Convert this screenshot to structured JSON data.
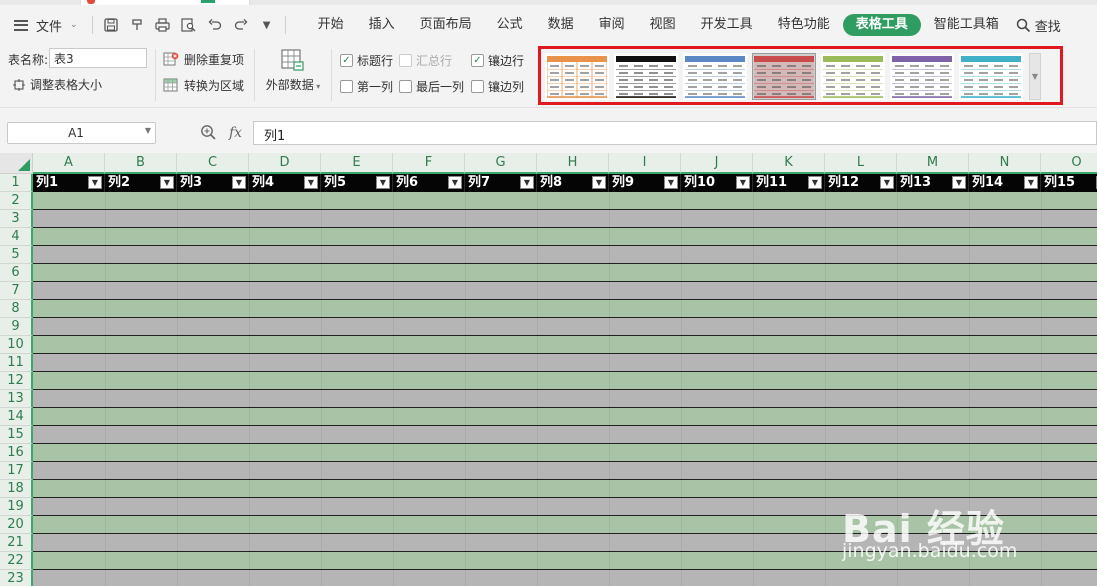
{
  "menu": {
    "file_label": "文件",
    "tabs": [
      {
        "label": "开始"
      },
      {
        "label": "插入"
      },
      {
        "label": "页面布局"
      },
      {
        "label": "公式"
      },
      {
        "label": "数据"
      },
      {
        "label": "审阅"
      },
      {
        "label": "视图"
      },
      {
        "label": "开发工具"
      },
      {
        "label": "特色功能"
      },
      {
        "label": "表格工具",
        "active": true
      },
      {
        "label": "智能工具箱"
      }
    ],
    "search_label": "查找",
    "quick_access_icons": [
      "save-icon",
      "format-painter-icon",
      "print-icon",
      "print-preview-icon",
      "undo-icon",
      "redo-icon",
      "customize-icon"
    ]
  },
  "ribbon": {
    "table_name_label": "表名称:",
    "table_name_value": "表3",
    "resize_label": "调整表格大小",
    "remove_dup_label": "删除重复项",
    "convert_label": "转换为区域",
    "external_data_label": "外部数据",
    "checkboxes": [
      {
        "label": "标题行",
        "checked": true,
        "enabled": true
      },
      {
        "label": "汇总行",
        "checked": false,
        "enabled": false
      },
      {
        "label": "镶边行",
        "checked": true,
        "enabled": true
      },
      {
        "label": "第一列",
        "checked": false,
        "enabled": true
      },
      {
        "label": "最后一列",
        "checked": false,
        "enabled": true
      },
      {
        "label": "镶边列",
        "checked": false,
        "enabled": true
      }
    ],
    "table_styles": [
      {
        "name": "orange-style",
        "accent": "#e8924a",
        "selected": false
      },
      {
        "name": "black-style",
        "accent": "#111111",
        "selected": false
      },
      {
        "name": "blue-style",
        "accent": "#5b87c5",
        "selected": false
      },
      {
        "name": "red-style",
        "accent": "#c84c4c",
        "selected": true
      },
      {
        "name": "green-style",
        "accent": "#9bbb59",
        "selected": false
      },
      {
        "name": "purple-style",
        "accent": "#7f63a8",
        "selected": false
      },
      {
        "name": "teal-style",
        "accent": "#3fb0c8",
        "selected": false
      }
    ]
  },
  "formula_bar": {
    "name_box": "A1",
    "fx_label": "fx",
    "formula": "列1"
  },
  "sheet": {
    "column_letters": [
      "A",
      "B",
      "C",
      "D",
      "E",
      "F",
      "G",
      "H",
      "I",
      "J",
      "K",
      "L",
      "M",
      "N",
      "O"
    ],
    "header_cells": [
      "列1",
      "列2",
      "列3",
      "列4",
      "列5",
      "列6",
      "列7",
      "列8",
      "列9",
      "列10",
      "列11",
      "列12",
      "列13",
      "列14",
      "列15"
    ],
    "row_numbers": [
      "1",
      "2",
      "3",
      "4",
      "5",
      "6",
      "7",
      "8",
      "9",
      "10",
      "11",
      "12",
      "13",
      "14",
      "15",
      "16",
      "17",
      "18",
      "19",
      "20",
      "21",
      "22",
      "23"
    ]
  },
  "watermark": {
    "logo": "Bai 经验",
    "url": "jingyan.baidu.com"
  },
  "colors": {
    "accent_green": "#2f9d62",
    "header_row": "#050505",
    "band_green": "#a8c3a6",
    "band_gray": "#b5b5b5",
    "highlight_red": "#e0181f"
  }
}
